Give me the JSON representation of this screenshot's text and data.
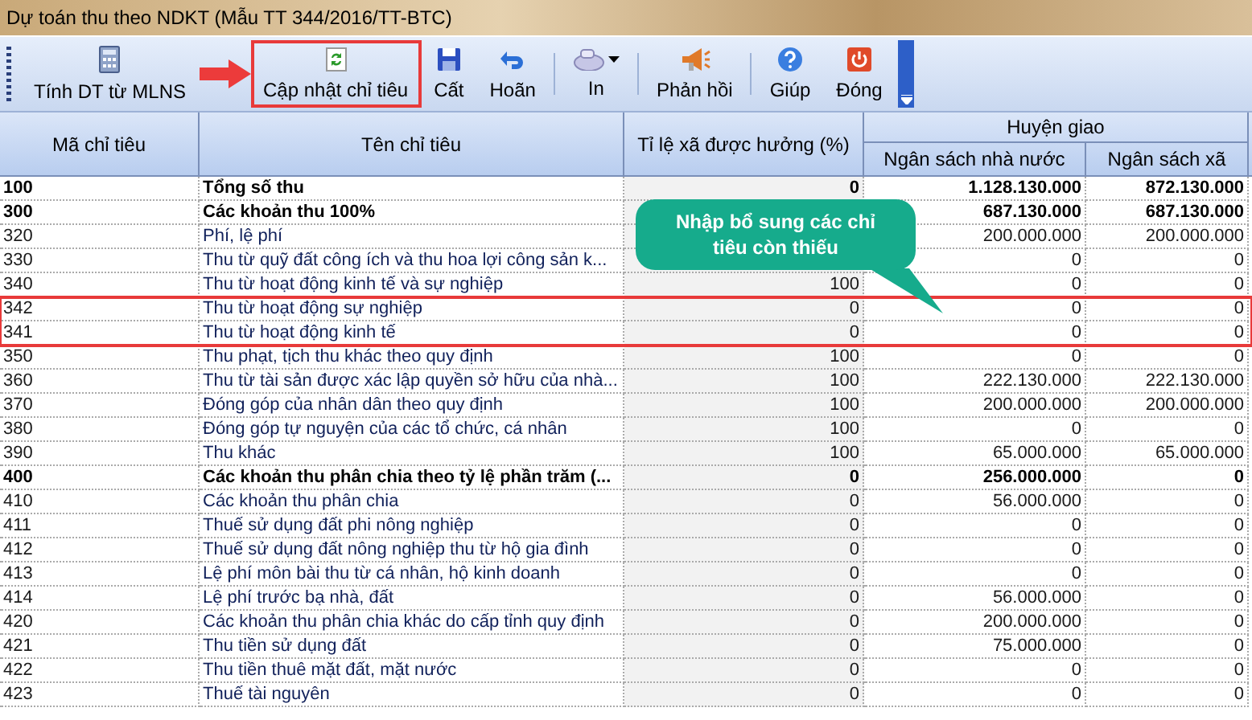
{
  "window": {
    "title": "Dự toán thu theo NDKT (Mẫu TT 344/2016/TT-BTC)"
  },
  "toolbar": [
    {
      "label": "Tính DT từ MLNS",
      "kind": "calculator",
      "annotated": false
    },
    {
      "label": "Cập nhật chỉ tiêu",
      "kind": "refresh",
      "annotated": true
    },
    {
      "label": "Cất",
      "kind": "save",
      "annotated": false
    },
    {
      "label": "Hoãn",
      "kind": "undo",
      "annotated": false
    },
    {
      "label": "In",
      "kind": "print",
      "annotated": false
    },
    {
      "label": "Phản hồi",
      "kind": "feedback",
      "annotated": false
    },
    {
      "label": "Giúp",
      "kind": "help",
      "annotated": false
    },
    {
      "label": "Đóng",
      "kind": "close",
      "annotated": false
    }
  ],
  "table": {
    "columns": [
      "Mã chỉ tiêu",
      "Tên chỉ tiêu",
      "Tỉ lệ xã được hưởng (%)"
    ],
    "group": {
      "label": "Huyện giao",
      "columns": [
        "Ngân sách nhà nước",
        "Ngân sách xã"
      ]
    },
    "rows": [
      {
        "code": "100",
        "name": "Tổng số thu",
        "ratio": "0",
        "state": "1.128.130.000",
        "commune": "872.130.000",
        "bold": true,
        "highlighted": false
      },
      {
        "code": "300",
        "name": "Các khoản thu 100%",
        "state": "687.130.000",
        "commune": "687.130.000",
        "bold": true,
        "highlighted": false
      },
      {
        "code": "320",
        "name": "Phí, lệ phí",
        "state": "200.000.000",
        "commune": "200.000.000",
        "bold": false,
        "highlighted": false
      },
      {
        "code": "330",
        "name": "Thu từ quỹ đất công ích và thu hoa lợi công sản k...",
        "state": "0",
        "commune": "0",
        "bold": false,
        "highlighted": false
      },
      {
        "code": "340",
        "name": "Thu từ hoạt động kinh tế và sự nghiệp",
        "ratio": "100",
        "state": "0",
        "commune": "0",
        "bold": false,
        "highlighted": false
      },
      {
        "code": "342",
        "name": "Thu từ hoạt động sự nghiệp",
        "ratio": "0",
        "state": "0",
        "commune": "0",
        "bold": false,
        "highlighted": true
      },
      {
        "code": "341",
        "name": "Thu từ hoạt động kinh tế",
        "ratio": "0",
        "state": "0",
        "commune": "0",
        "bold": false,
        "highlighted": true
      },
      {
        "code": "350",
        "name": "Thu phạt, tịch thu khác theo quy định",
        "ratio": "100",
        "state": "0",
        "commune": "0",
        "bold": false,
        "highlighted": false
      },
      {
        "code": "360",
        "name": "Thu từ tài sản được xác lập quyền sở hữu của nhà...",
        "ratio": "100",
        "state": "222.130.000",
        "commune": "222.130.000",
        "bold": false,
        "highlighted": false
      },
      {
        "code": "370",
        "name": "Đóng góp của nhân dân theo quy định",
        "ratio": "100",
        "state": "200.000.000",
        "commune": "200.000.000",
        "bold": false,
        "highlighted": false
      },
      {
        "code": "380",
        "name": "Đóng góp tự nguyện của các tổ chức, cá nhân",
        "ratio": "100",
        "state": "0",
        "commune": "0",
        "bold": false,
        "highlighted": false
      },
      {
        "code": "390",
        "name": "Thu khác",
        "ratio": "100",
        "state": "65.000.000",
        "commune": "65.000.000",
        "bold": false,
        "highlighted": false
      },
      {
        "code": "400",
        "name": "Các khoản thu phân chia theo tỷ lệ phần trăm (...",
        "ratio": "0",
        "state": "256.000.000",
        "commune": "0",
        "bold": true,
        "highlighted": false
      },
      {
        "code": "410",
        "name": "Các khoản thu phân chia",
        "ratio": "0",
        "state": "56.000.000",
        "commune": "0",
        "bold": false,
        "highlighted": false
      },
      {
        "code": "411",
        "name": "Thuế sử dụng đất phi nông nghiệp",
        "ratio": "0",
        "state": "0",
        "commune": "0",
        "bold": false,
        "highlighted": false
      },
      {
        "code": "412",
        "name": "Thuế sử dụng đất nông nghiệp thu từ hộ gia đình",
        "ratio": "0",
        "state": "0",
        "commune": "0",
        "bold": false,
        "highlighted": false
      },
      {
        "code": "413",
        "name": "Lệ phí môn bài thu từ cá nhân, hộ kinh doanh",
        "ratio": "0",
        "state": "0",
        "commune": "0",
        "bold": false,
        "highlighted": false
      },
      {
        "code": "414",
        "name": "Lệ phí trước bạ nhà, đất",
        "ratio": "0",
        "state": "56.000.000",
        "commune": "0",
        "bold": false,
        "highlighted": false
      },
      {
        "code": "420",
        "name": "Các khoản thu phân chia khác do cấp tỉnh quy định",
        "ratio": "0",
        "state": "200.000.000",
        "commune": "0",
        "bold": false,
        "highlighted": false
      },
      {
        "code": "421",
        "name": "Thu tiền sử dụng đất",
        "ratio": "0",
        "state": "75.000.000",
        "commune": "0",
        "bold": false,
        "highlighted": false
      },
      {
        "code": "422",
        "name": "Thu tiền thuê mặt đất, mặt nước",
        "ratio": "0",
        "state": "0",
        "commune": "0",
        "bold": false,
        "highlighted": false
      },
      {
        "code": "423",
        "name": "Thuế tài nguyên",
        "ratio": "0",
        "state": "0",
        "commune": "0",
        "bold": false,
        "highlighted": false
      }
    ]
  },
  "callout": {
    "text": "Nhập bổ sung các chỉ tiêu còn thiếu"
  }
}
